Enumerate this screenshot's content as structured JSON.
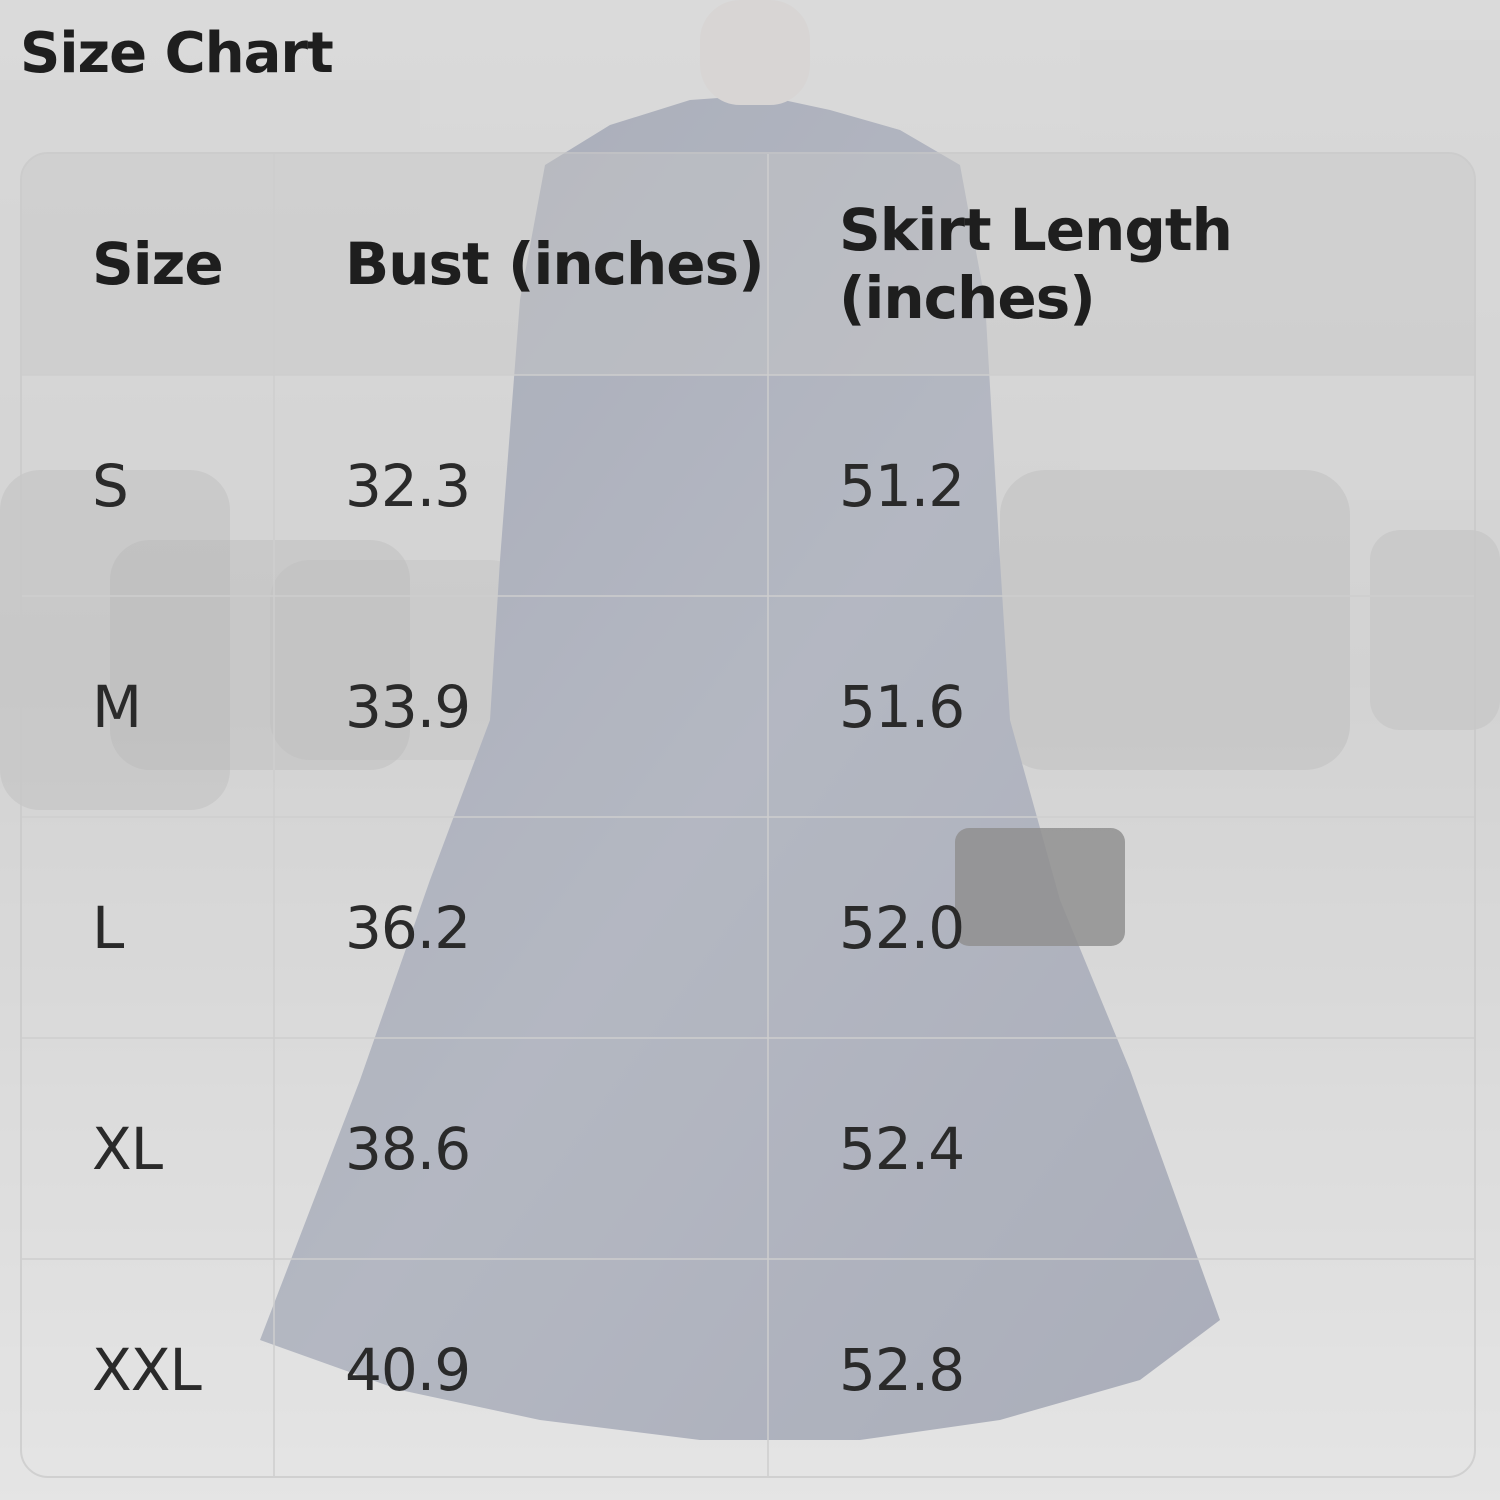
{
  "title": "Size Chart",
  "table": {
    "headers": [
      "Size",
      "Bust (inches)",
      "Skirt Length (inches)"
    ],
    "rows": [
      [
        "S",
        "32.3",
        "51.2"
      ],
      [
        "M",
        "33.9",
        "51.6"
      ],
      [
        "L",
        "36.2",
        "52.0"
      ],
      [
        "XL",
        "38.6",
        "52.4"
      ],
      [
        "XXL",
        "40.9",
        "52.8"
      ]
    ]
  },
  "colors": {
    "dress": "#6f7790",
    "background": "#d9d9d9",
    "text": "#1e1e1e"
  }
}
